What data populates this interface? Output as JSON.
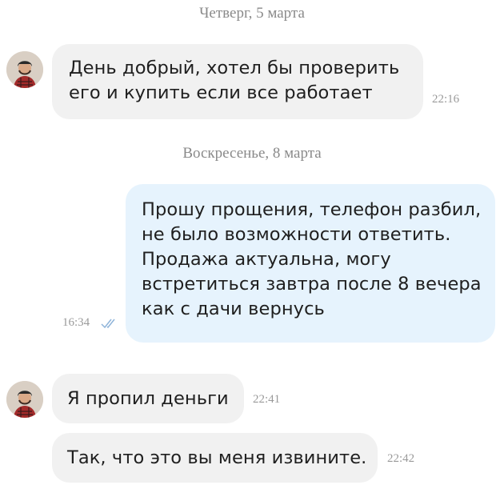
{
  "dates": {
    "first": "Четверг, 5 марта",
    "second": "Воскресенье, 8 марта"
  },
  "messages": [
    {
      "direction": "incoming",
      "lines": [
        "День добрый, хотел бы проверить",
        "его и купить если все работает"
      ],
      "time": "22:16"
    },
    {
      "direction": "outgoing",
      "lines": [
        "Прошу прощения, телефон разбил,",
        "не было возможности ответить.",
        "Продажа актуальна, могу",
        "встретиться завтра после 8 вечера",
        "как с дачи вернусь"
      ],
      "time": "16:34",
      "status_icon": "double-check-icon"
    },
    {
      "direction": "incoming",
      "lines": [
        "Я пропил деньги"
      ],
      "time": "22:41"
    },
    {
      "direction": "incoming",
      "lines": [
        "Так, что это вы меня извините."
      ],
      "time": "22:42"
    }
  ],
  "colors": {
    "incoming_bubble": "#f1f1f1",
    "outgoing_bubble": "#e6f3fd",
    "meta_text": "#8a8a8a",
    "read_check": "#8fb4d9"
  }
}
